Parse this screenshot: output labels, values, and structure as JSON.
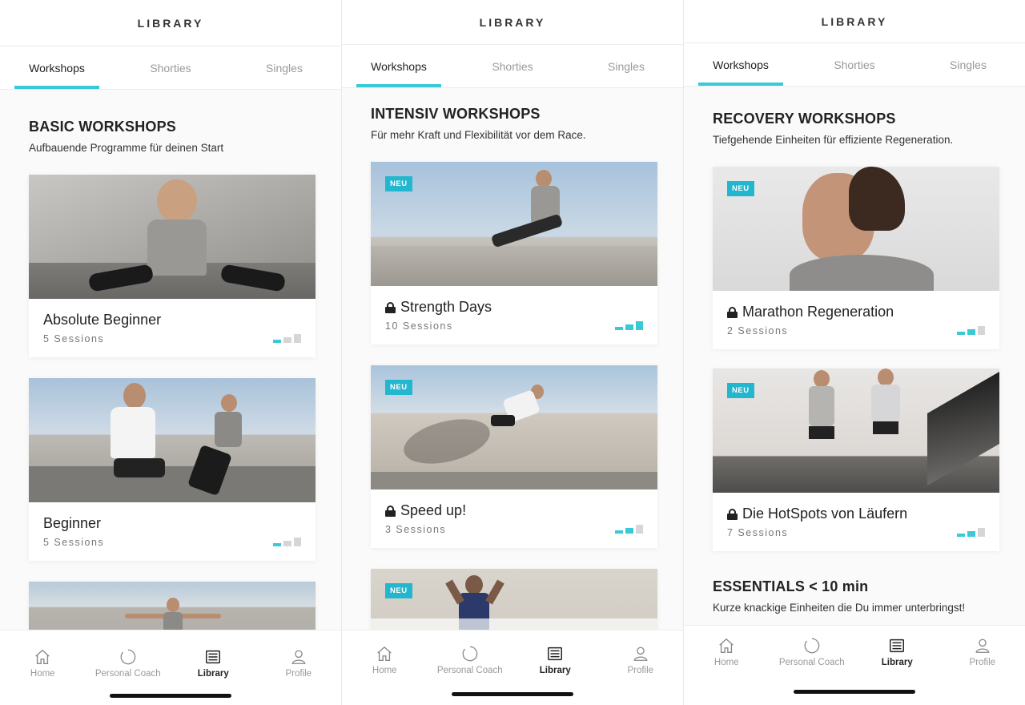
{
  "screens": [
    {
      "header": {
        "title": "LIBRARY"
      },
      "tabs": [
        {
          "label": "Workshops"
        },
        {
          "label": "Shorties"
        },
        {
          "label": "Singles"
        }
      ],
      "section": {
        "title": "BASIC WORKSHOPS",
        "subtitle": "Aufbauende Programme für deinen Start"
      },
      "cards": [
        {
          "name": "Absolute Beginner",
          "sessions": "5 Sessions",
          "locked": false,
          "badge": "",
          "level": 1
        },
        {
          "name": "Beginner",
          "sessions": "5 Sessions",
          "locked": false,
          "badge": "",
          "level": 1
        },
        {
          "name": "",
          "sessions": "",
          "locked": false,
          "badge": "",
          "level": 0
        }
      ],
      "nav": [
        {
          "label": "Home"
        },
        {
          "label": "Personal Coach"
        },
        {
          "label": "Library"
        },
        {
          "label": "Profile"
        }
      ]
    },
    {
      "header": {
        "title": "LIBRARY"
      },
      "tabs": [
        {
          "label": "Workshops"
        },
        {
          "label": "Shorties"
        },
        {
          "label": "Singles"
        }
      ],
      "section": {
        "title": "INTENSIV WORKSHOPS",
        "subtitle": "Für mehr Kraft und Flexibilität vor dem Race."
      },
      "cards": [
        {
          "name": "Strength Days",
          "sessions": "10 Sessions",
          "locked": true,
          "badge": "NEU",
          "level": 3
        },
        {
          "name": "Speed up!",
          "sessions": "3 Sessions",
          "locked": true,
          "badge": "NEU",
          "level": 2
        },
        {
          "name": "",
          "sessions": "",
          "locked": false,
          "badge": "NEU",
          "level": 0
        }
      ],
      "nav": [
        {
          "label": "Home"
        },
        {
          "label": "Personal Coach"
        },
        {
          "label": "Library"
        },
        {
          "label": "Profile"
        }
      ]
    },
    {
      "header": {
        "title": "LIBRARY"
      },
      "tabs": [
        {
          "label": "Workshops"
        },
        {
          "label": "Shorties"
        },
        {
          "label": "Singles"
        }
      ],
      "section": {
        "title": "RECOVERY  WORKSHOPS",
        "subtitle": "Tiefgehende Einheiten für effiziente Regeneration."
      },
      "cards": [
        {
          "name": "Marathon Regeneration",
          "sessions": "2 Sessions",
          "locked": true,
          "badge": "NEU",
          "level": 2
        },
        {
          "name": "Die HotSpots von Läufern",
          "sessions": "7 Sessions",
          "locked": true,
          "badge": "NEU",
          "level": 2
        }
      ],
      "section2": {
        "title": "ESSENTIALS < 10 min",
        "subtitle": "Kurze knackige Einheiten die Du immer unterbringst!"
      },
      "nav": [
        {
          "label": "Home"
        },
        {
          "label": "Personal Coach"
        },
        {
          "label": "Library"
        },
        {
          "label": "Profile"
        }
      ]
    }
  ],
  "colors": {
    "accent": "#3bc9d6",
    "badge": "#23b6cf",
    "inactive": "#d6d6d6"
  },
  "active_tab": "Workshops",
  "active_nav": "Library"
}
